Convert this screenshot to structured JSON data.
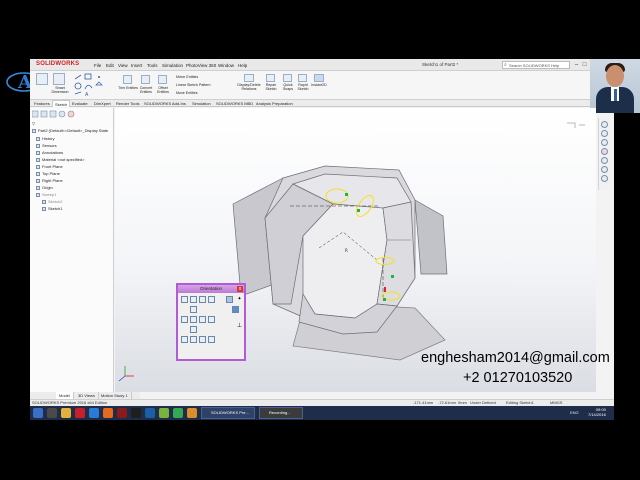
{
  "app": {
    "brand": "SOLIDWORKS",
    "document_title": "Sketch1 of Part2 *",
    "help_search_placeholder": "Search SOLIDWORKS Help",
    "window_controls": [
      "–",
      "□",
      "✕"
    ]
  },
  "menu": [
    "File",
    "Edit",
    "View",
    "Insert",
    "Tools",
    "Simulation",
    "PhotoView 360",
    "Window",
    "Help"
  ],
  "ribbon": {
    "sketch_tools": [
      "Smart Dimension"
    ],
    "group_small": [
      "Mirror Entities",
      "Linear Sketch Pattern",
      "Move Entities"
    ],
    "buttons": [
      "Trim Entities",
      "Convert Entities",
      "Offset Entities",
      "Display/Delete Relations",
      "Repair Sketch",
      "Quick Snaps",
      "Rapid Sketch",
      "Instant2D"
    ]
  },
  "tabs": [
    {
      "label": "Features",
      "active": false
    },
    {
      "label": "Sketch",
      "active": true
    },
    {
      "label": "Evaluate",
      "active": false
    },
    {
      "label": "DimXpert",
      "active": false
    },
    {
      "label": "Render Tools",
      "active": false
    },
    {
      "label": "SOLIDWORKS Add-Ins",
      "active": false
    },
    {
      "label": "Simulation",
      "active": false
    },
    {
      "label": "SOLIDWORKS MBD",
      "active": false
    },
    {
      "label": "Analysis Preparation",
      "active": false
    }
  ],
  "tree": {
    "root": "Part2 (Default<<Default>_Display State",
    "items": [
      {
        "label": "History",
        "dim": false
      },
      {
        "label": "Sensors",
        "dim": false
      },
      {
        "label": "Annotations",
        "dim": false
      },
      {
        "label": "Material <not specified>",
        "dim": false
      },
      {
        "label": "Front Plane",
        "dim": false
      },
      {
        "label": "Top Plane",
        "dim": false
      },
      {
        "label": "Right Plane",
        "dim": false
      },
      {
        "label": "Origin",
        "dim": false
      },
      {
        "label": "Sweep1",
        "dim": true
      },
      {
        "label": "Sketch2",
        "dim": true
      },
      {
        "label": "Sketch1",
        "dim": false
      }
    ]
  },
  "orientation_panel": {
    "title": "Orientation",
    "close_label": "x"
  },
  "bottom_tabs": [
    {
      "label": "Model",
      "active": true
    },
    {
      "label": "3D Views",
      "active": false
    },
    {
      "label": "Motion Study 1",
      "active": false
    }
  ],
  "status": {
    "edition": "SOLIDWORKS Premium 2016 x64 Edition",
    "x": "-171.41mm",
    "y": "-72.61mm",
    "z": "0mm",
    "state": "Under Defined",
    "editing": "Editing Sketch1",
    "units": "MMGS"
  },
  "taskbar": {
    "items": [
      "SOLIDWORKS Pre...",
      "Recording..."
    ],
    "tray": [
      "ENG"
    ],
    "time": "09:00",
    "date": "7/14/2016"
  },
  "overlay": {
    "email": "enghesham2014@gmail.com",
    "phone": "+2 01270103520"
  },
  "colors": {
    "accent_purple": "#b35ad6",
    "sketch_yellow": "#f5e020",
    "relation_green": "#18b83a",
    "taskbar": "#1f2d4a"
  }
}
